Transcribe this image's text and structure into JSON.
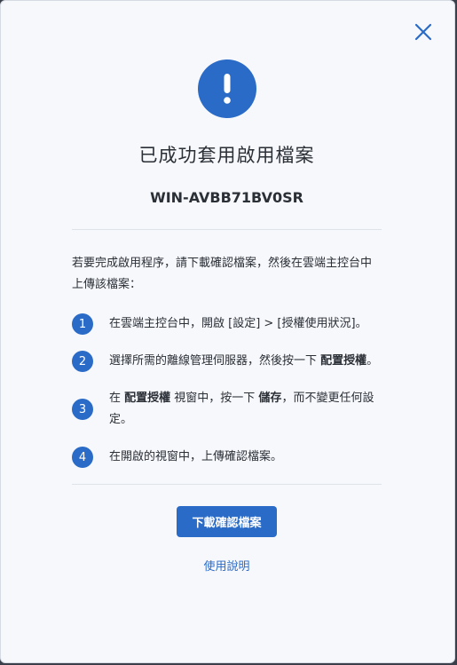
{
  "dialog": {
    "close_label": "close",
    "title": "已成功套用啟用檔案",
    "device_name": "WIN-AVBB71BV0SR",
    "intro": "若要完成啟用程序，請下載確認檔案，然後在雲端主控台中上傳該檔案：",
    "steps": [
      {
        "num": "1",
        "text": "在雲端主控台中，開啟 [設定] > [授權使用狀況]。"
      },
      {
        "num": "2",
        "pre": "選擇所需的離線管理伺服器，然後按一下 ",
        "bold": "配置授權",
        "post": "。"
      },
      {
        "num": "3",
        "pre": "在 ",
        "bold": "配置授權",
        "mid": " 視窗中，按一下 ",
        "bold2": "儲存",
        "post": "，而不變更任何設定。"
      },
      {
        "num": "4",
        "text": "在開啟的視窗中，上傳確認檔案。"
      }
    ],
    "download_button": "下載確認檔案",
    "help_link": "使用說明"
  },
  "colors": {
    "accent": "#2a6bc7",
    "text": "#2b2f36",
    "background": "#f6f8fc"
  },
  "icons": {
    "close": "close-icon",
    "alert": "exclamation-icon"
  }
}
